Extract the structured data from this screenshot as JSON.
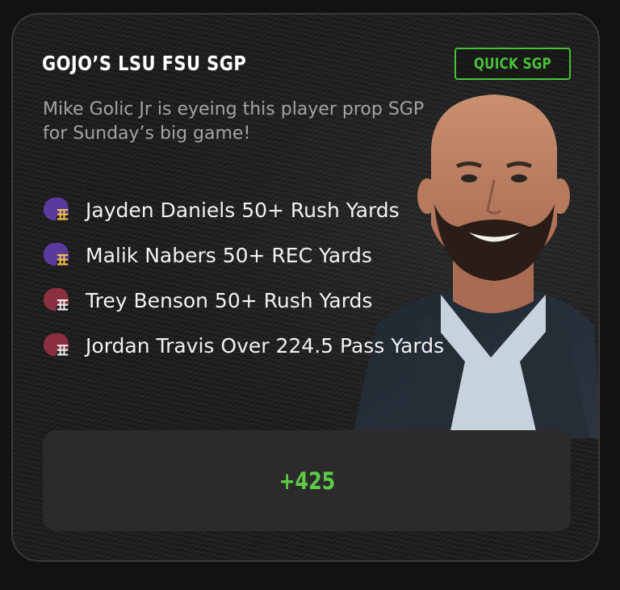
{
  "card": {
    "title": "GOJO’S LSU FSU SGP",
    "badge": "QUICK SGP",
    "subtitle": "Mike Golic Jr is eyeing this player prop SGP for Sunday’s big game!",
    "legs": [
      {
        "text": "Jayden Daniels 50+ Rush Yards",
        "icon": "helmet-icon",
        "team_color": "#5b3a9e"
      },
      {
        "text": "Malik Nabers 50+ REC Yards",
        "icon": "helmet-icon",
        "team_color": "#5b3a9e"
      },
      {
        "text": "Trey Benson 50+ Rush Yards",
        "icon": "helmet-icon",
        "team_color": "#8a2f3d"
      },
      {
        "text": "Jordan Travis Over 224.5 Pass Yards",
        "icon": "helmet-icon",
        "team_color": "#8a2f3d"
      }
    ],
    "odds": "+425"
  },
  "colors": {
    "accent_green": "#49c13b",
    "odds_green": "#5ecb47",
    "background": "#121212",
    "card": "#1d1d1d"
  }
}
